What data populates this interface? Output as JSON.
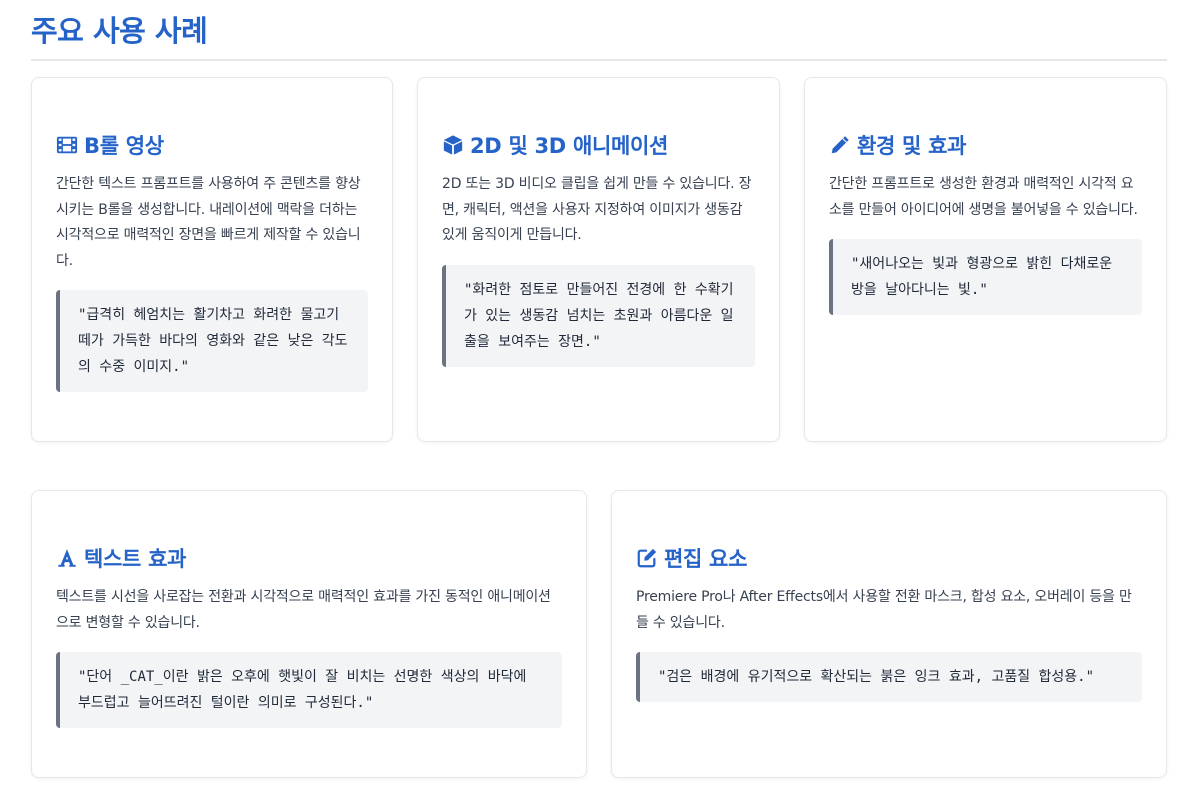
{
  "section": {
    "title": "주요 사용 사례"
  },
  "colors": {
    "accent": "#2563c9",
    "quote_border": "#6b7280",
    "quote_bg": "#f3f4f6"
  },
  "cards": [
    {
      "icon": "film-icon",
      "title": "B롤 영상",
      "desc": "간단한 텍스트 프롬프트를 사용하여 주 콘텐츠를 향상시키는 B롤을 생성합니다. 내레이션에 맥락을 더하는 시각적으로 매력적인 장면을 빠르게 제작할 수 있습니다.",
      "prompt": "\"급격히 헤엄치는 활기차고 화려한 물고기 떼가 가득한 바다의 영화와 같은 낮은 각도의 수중 이미지.\""
    },
    {
      "icon": "cube-icon",
      "title": "2D 및 3D 애니메이션",
      "desc": "2D 또는 3D 비디오 클립을 쉽게 만들 수 있습니다. 장면, 캐릭터, 액션을 사용자 지정하여 이미지가 생동감 있게 움직이게 만듭니다.",
      "prompt": "\"화려한 점토로 만들어진 전경에 한 수확기가 있는 생동감 넘치는 초원과 아름다운 일출을 보여주는 장면.\""
    },
    {
      "icon": "pencil-icon",
      "title": "환경 및 효과",
      "desc": "간단한 프롬프트로 생성한 환경과 매력적인 시각적 요소를 만들어 아이디어에 생명을 불어넣을 수 있습니다.",
      "prompt": "\"새어나오는 빛과 형광으로 밝힌 다채로운 방을 날아다니는 빛.\""
    },
    {
      "icon": "text-font-icon",
      "title": "텍스트 효과",
      "desc": "텍스트를 시선을 사로잡는 전환과 시각적으로 매력적인 효과를 가진 동적인 애니메이션으로 변형할 수 있습니다.",
      "prompt": "\"단어 _CAT_이란 밝은 오후에 햇빛이 잘 비치는 선명한 색상의 바닥에 부드럽고 늘어뜨려진 털이란 의미로 구성된다.\""
    },
    {
      "icon": "edit-icon",
      "title": "편집 요소",
      "desc": "Premiere Pro나 After Effects에서 사용할 전환 마스크, 합성 요소, 오버레이 등을 만들 수 있습니다.",
      "prompt": "\"검은 배경에 유기적으로 확산되는 붉은 잉크 효과, 고품질 합성용.\""
    }
  ]
}
